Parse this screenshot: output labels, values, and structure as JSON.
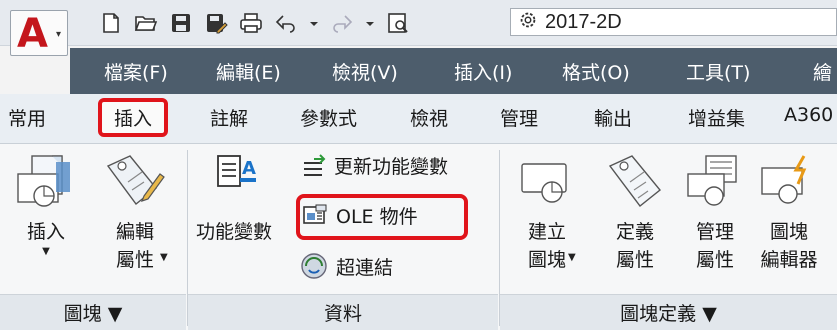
{
  "qat": {
    "workspace_value": "2017-2D",
    "icons": [
      "new-icon",
      "open-icon",
      "save-icon",
      "save-as-icon",
      "print-icon",
      "undo-icon",
      "undo-dropdown-icon",
      "redo-icon",
      "redo-dropdown-icon",
      "preview-icon",
      "gear-icon"
    ]
  },
  "menubar": {
    "items": [
      "檔案(F)",
      "編輯(E)",
      "檢視(V)",
      "插入(I)",
      "格式(O)",
      "工具(T)",
      "繪"
    ]
  },
  "tabs": {
    "items": [
      "常用",
      "插入",
      "註解",
      "參數式",
      "檢視",
      "管理",
      "輸出",
      "增益集",
      "A360"
    ],
    "active": "插入"
  },
  "panels": {
    "block": {
      "footer": "圖塊 ▼",
      "insert_label": "插入",
      "edit_attr_label_1": "編輯",
      "edit_attr_label_2": "屬性"
    },
    "data": {
      "footer": "資料",
      "field_label": "功能變數",
      "update_fields_label": "更新功能變數",
      "ole_label": "OLE 物件",
      "hyperlink_label": "超連結"
    },
    "block_def": {
      "footer": "圖塊定義 ▼",
      "create_1": "建立",
      "create_2": "圖塊",
      "define_attr_1": "定義",
      "define_attr_2": "屬性",
      "manage_attr_1": "管理",
      "manage_attr_2": "屬性",
      "block_editor_1": "圖塊",
      "block_editor_2": "編輯器"
    }
  },
  "colors": {
    "accent_red": "#e0141b",
    "menubar_bg": "#4d5d6c"
  }
}
